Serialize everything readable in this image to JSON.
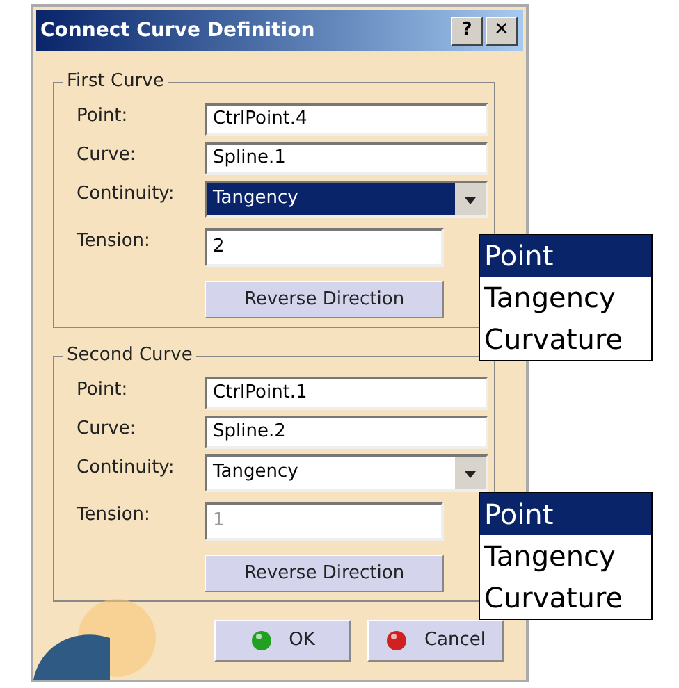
{
  "window": {
    "title": "Connect Curve Definition",
    "buttons": [
      "?",
      "✕"
    ]
  },
  "groups": [
    {
      "title": "First Curve",
      "point_label": "Point:",
      "point": "CtrlPoint.4",
      "curve_label": "Curve:",
      "curve": "Spline.1",
      "continuity_label": "Continuity:",
      "continuity": "Tangency",
      "continuity_highlighted": true,
      "tension_label": "Tension:",
      "tension": "2",
      "tension_disabled": false,
      "reverse": "Reverse Direction",
      "popup": [
        {
          "label": "Point",
          "selected": true
        },
        {
          "label": "Tangency",
          "selected": false
        },
        {
          "label": "Curvature",
          "selected": false
        }
      ]
    },
    {
      "title": "Second Curve",
      "point_label": "Point:",
      "point": "CtrlPoint.1",
      "curve_label": "Curve:",
      "curve": "Spline.2",
      "continuity_label": "Continuity:",
      "continuity": "Tangency",
      "continuity_highlighted": false,
      "tension_label": "Tension:",
      "tension": "1",
      "tension_disabled": true,
      "reverse": "Reverse Direction",
      "popup": [
        {
          "label": "Point",
          "selected": true
        },
        {
          "label": "Tangency",
          "selected": false
        },
        {
          "label": "Curvature",
          "selected": false
        }
      ]
    }
  ],
  "footer": [
    {
      "kind": "ok",
      "label": "OK"
    },
    {
      "kind": "cancel",
      "label": "Cancel"
    }
  ]
}
